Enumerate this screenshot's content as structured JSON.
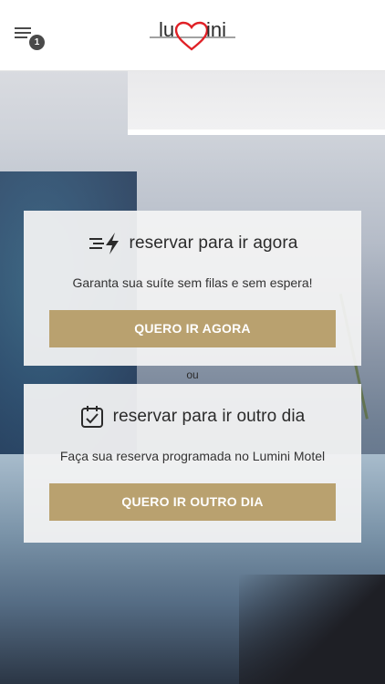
{
  "header": {
    "menu_icon": "hamburger-menu-icon",
    "menu_badge": "1",
    "logo_text_left": "lu",
    "logo_text_right": "ini",
    "logo_icon": "heart-icon",
    "logo_color": "#e02026"
  },
  "booking_now": {
    "icon": "fast-lightning-icon",
    "title": "reservar para ir agora",
    "description": "Garanta sua suíte sem filas e sem espera!",
    "button_label": "QUERO IR AGORA"
  },
  "separator": "ou",
  "booking_later": {
    "icon": "calendar-check-icon",
    "title": "reservar para ir outro dia",
    "description": "Faça sua reserva programada no Lumini Motel",
    "button_label": "QUERO IR OUTRO DIA"
  },
  "colors": {
    "accent_button": "#b9a16f",
    "card_background": "#f4f4f4",
    "text_dark": "#2b2b2b"
  }
}
